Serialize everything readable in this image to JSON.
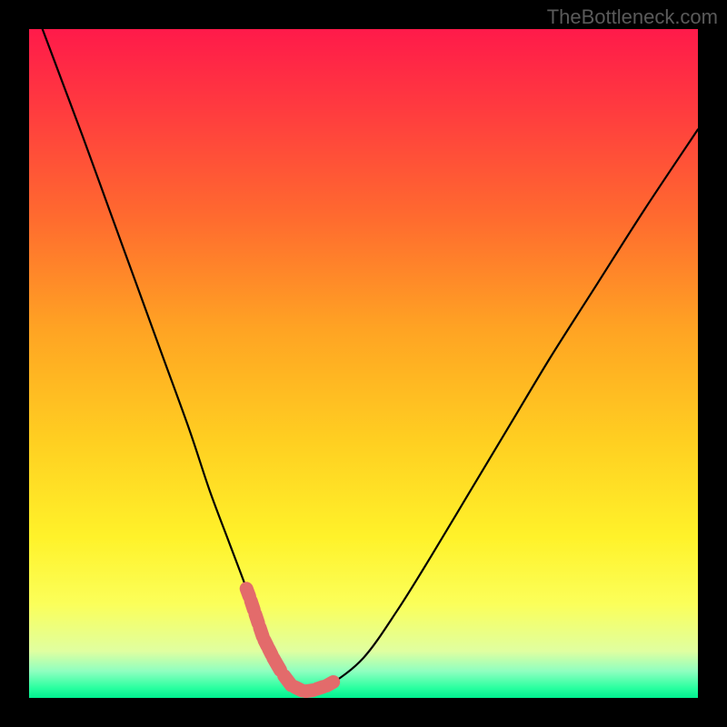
{
  "watermark": {
    "text": "TheBottleneck.com"
  },
  "chart_data": {
    "type": "line",
    "title": "",
    "xlabel": "",
    "ylabel": "",
    "ylim": [
      0,
      100
    ],
    "xlim": [
      0,
      100
    ],
    "series": [
      {
        "name": "bottleneck-curve",
        "x": [
          0,
          2,
          5,
          8,
          12,
          16,
          20,
          24,
          27,
          30,
          33,
          35,
          37,
          39,
          41,
          42,
          45,
          50,
          55,
          60,
          66,
          72,
          78,
          85,
          92,
          100
        ],
        "y": [
          105,
          100,
          92,
          84,
          73,
          62,
          51,
          40,
          31,
          23,
          15,
          9,
          5,
          2,
          1,
          1,
          2,
          6,
          13,
          21,
          31,
          41,
          51,
          62,
          73,
          85
        ]
      }
    ],
    "band_markers": {
      "left": {
        "x_range": [
          32.5,
          36.5
        ],
        "segments": 6
      },
      "floor": {
        "x_range": [
          36.5,
          43.0
        ],
        "segments": 4
      },
      "right": {
        "x_range": [
          43.0,
          46.0
        ],
        "segments": 2
      }
    },
    "colors": {
      "curve": "#000000",
      "markers": "#e36b6b",
      "gradient_top": "#ff1a4a",
      "gradient_bottom": "#00f090"
    }
  }
}
